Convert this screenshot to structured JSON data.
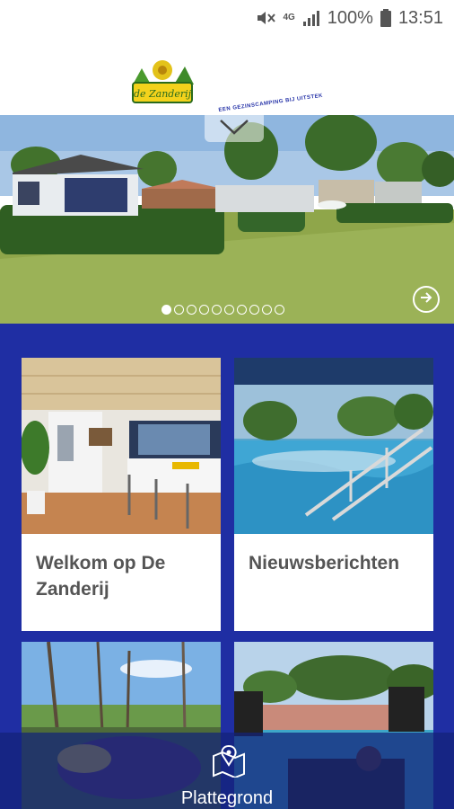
{
  "status_bar": {
    "network": "4G",
    "battery": "100%",
    "time": "13:51"
  },
  "header": {
    "logo_text": "de Zanderij",
    "tagline": "EEN GEZINSCAMPING BIJ UITSTEK"
  },
  "slider": {
    "slide_count": 10,
    "active_index": 0,
    "icons": [
      "chevron-down-icon",
      "arrow-right-circle-icon"
    ]
  },
  "tiles": [
    {
      "label": "Welkom op De Zanderij"
    },
    {
      "label": "Nieuwsberichten"
    }
  ],
  "bottom_bar": {
    "icon": "map-pin-icon",
    "label": "Plattegrond"
  },
  "colors": {
    "accent_blue": "#1f2ea3",
    "text_gray": "#555555"
  }
}
